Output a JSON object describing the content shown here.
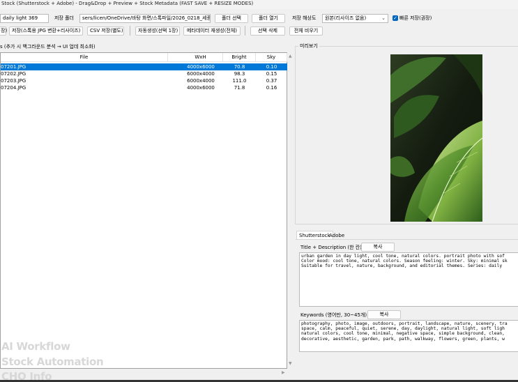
{
  "window": {
    "title": "Stock (Shutterstock + Adobe) - Drag&Drop + Preview + Stock Metadata (FAST SAVE + RESIZE MODES)"
  },
  "toolbar1": {
    "series_value": "daily light 369",
    "save_folder_label": "저장 폴더",
    "save_folder_path": "sers/licen/OneDrive/바탕 화면/스톡파일/2026_0218_세종시",
    "select_folder": "폴더 선택",
    "open_folder": "폴더 열기",
    "resolution_label": "저장 해상도",
    "resolution_value": "원본(리사이즈 없음)",
    "fast_save_label": "빠른 저장(권장)"
  },
  "toolbar2": {
    "cut_left": "장)",
    "save_stock_jpg": "저장(스톡용 JPG 변환+리사이즈)",
    "csv_save": "CSV 저장(별도)",
    "auto_generate": "자동생성(선택 1장)",
    "metadata_regen": "메타데이터 재생성(전체)",
    "delete_selected": "선택 삭제",
    "clear_all": "전체 비우기"
  },
  "status_text": "s (추가 시 백그라운드 분석 → UI 업데 최소화)",
  "table": {
    "headers": [
      "File",
      "WxH",
      "Bright",
      "Sky"
    ],
    "rows": [
      {
        "file": "07201.JPG",
        "wxh": "4000x6000",
        "bright": "70.8",
        "sky": "0.10",
        "selected": true
      },
      {
        "file": "07202.JPG",
        "wxh": "6000x4000",
        "bright": "98.3",
        "sky": "0.15",
        "selected": false
      },
      {
        "file": "07203.JPG",
        "wxh": "6000x4000",
        "bright": "111.0",
        "sky": "0.37",
        "selected": false
      },
      {
        "file": "07204.JPG",
        "wxh": "4000x6000",
        "bright": "71.8",
        "sky": "0.16",
        "selected": false
      }
    ]
  },
  "preview": {
    "label": "미리보기",
    "image_alt": "leaf-photo"
  },
  "tabs": [
    "Shutterstock",
    "Adobe"
  ],
  "title_section": {
    "label": "Title + Description (한 칸)",
    "copy": "복사",
    "text": "urban garden in day light, cool tone, natural colors. portrait photo with sof\nColor mood: cool tone, natural colors. Season feeling: winter. Sky: minimal sk\nSuitable for travel, nature, background, and editorial themes. Series: daily"
  },
  "keywords_section": {
    "label": "Keywords (영어만, 30~45개)",
    "copy": "복사",
    "text": "photography, photo, image, outdoors, portrait, landscape, nature, scenery, tra\nspace, calm, peaceful, quiet, serene, day, daylight, natural light, soft ligh\nnatural colors, cool tone, minimal, negative space, simple background, clean,\ndecorative, aesthetic, garden, park, path, walkway, flowers, green, plants, w"
  },
  "watermark": [
    "AI Workflow",
    "Stock Automation",
    "CHO Info"
  ],
  "colors": {
    "accent": "#0078d7",
    "check": "#0067c0"
  }
}
